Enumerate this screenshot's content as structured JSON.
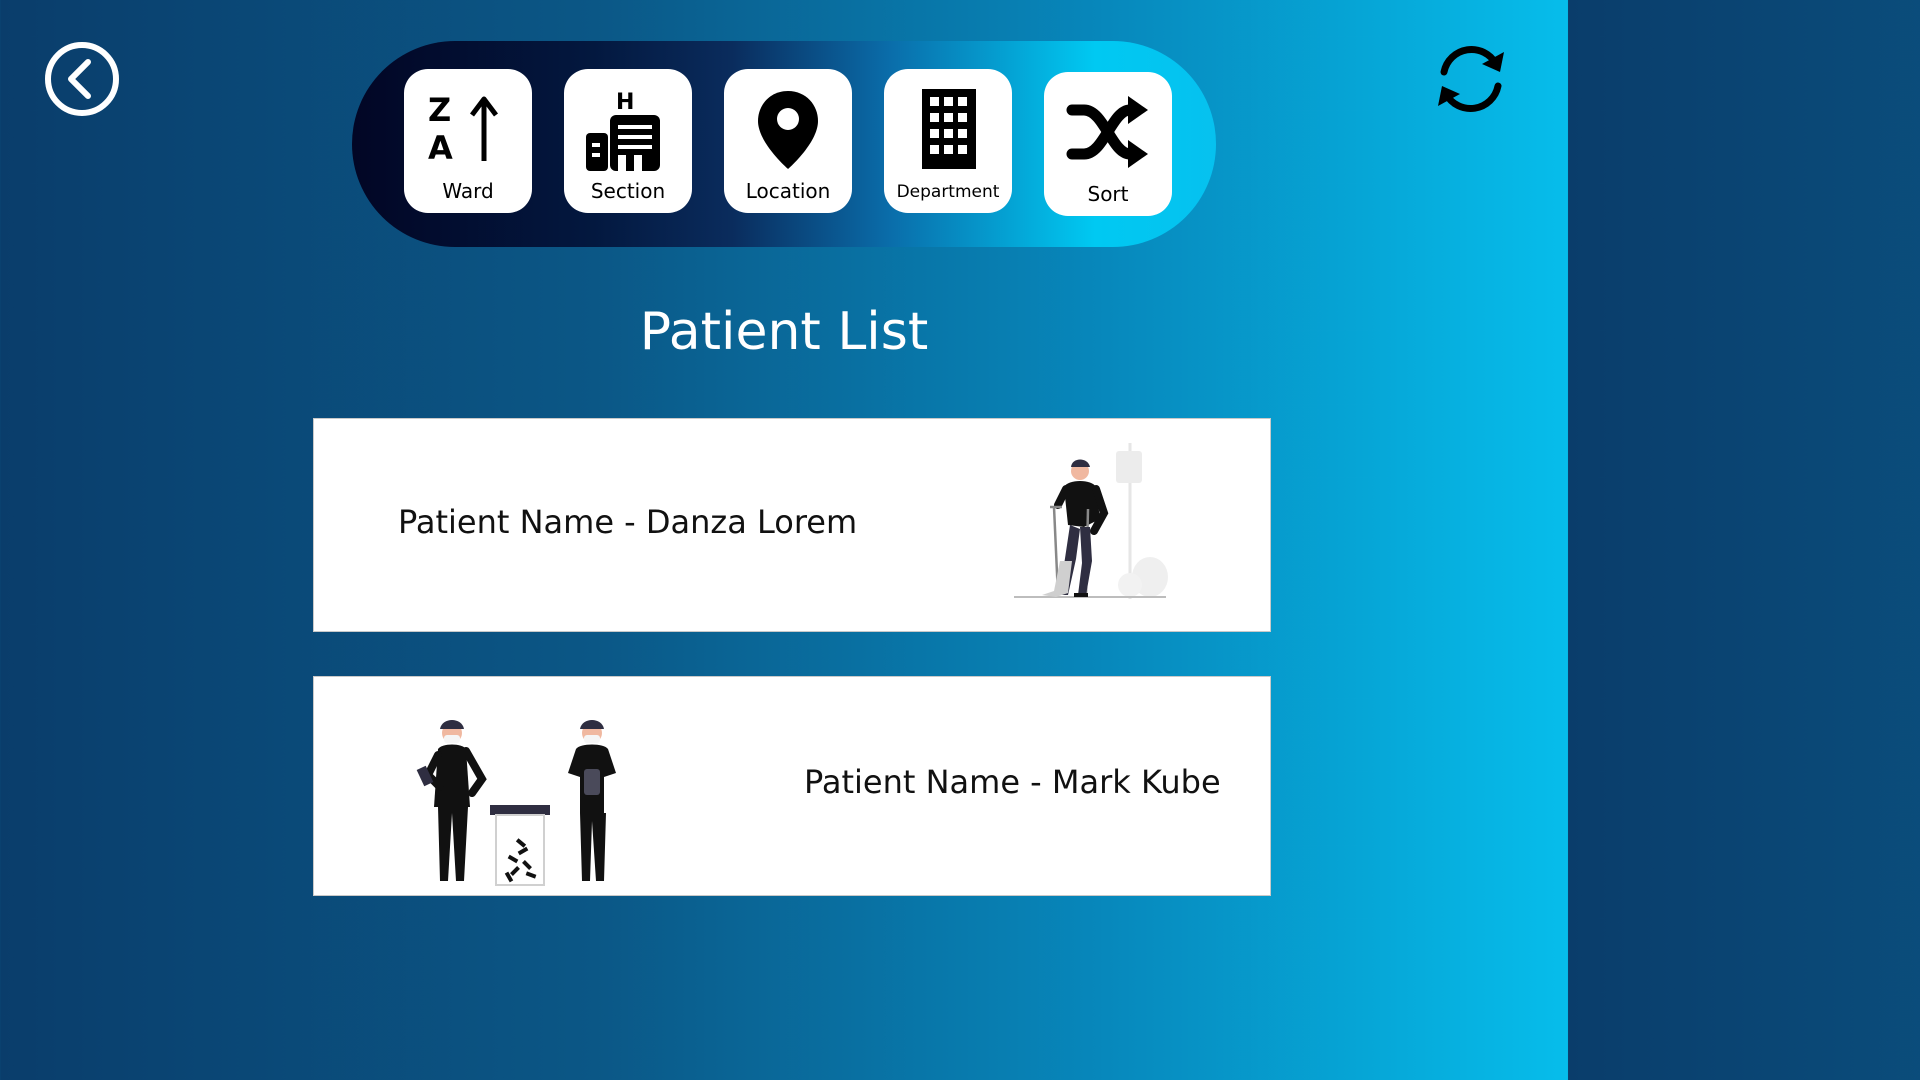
{
  "header": {
    "back_icon": "chevron-left-circle-icon",
    "refresh_icon": "refresh-icon"
  },
  "filters": [
    {
      "label": "Ward",
      "icon": "sort-za-ascending-icon"
    },
    {
      "label": "Section",
      "icon": "hospital-building-icon"
    },
    {
      "label": "Location",
      "icon": "location-pin-icon"
    },
    {
      "label": "Department",
      "icon": "office-building-icon"
    },
    {
      "label": "Sort",
      "icon": "shuffle-icon"
    }
  ],
  "title": "Patient List",
  "patients": [
    {
      "name": "Patient Name - Danza Lorem",
      "illustration": "patient-on-crutches-illustration"
    },
    {
      "name": "Patient Name - Mark Kube",
      "illustration": "doctors-with-medicine-jar-illustration"
    }
  ],
  "colors": {
    "background_start": "#0a3d6b",
    "background_end": "#06bdeb",
    "card": "#ffffff",
    "text_dark": "#111111"
  }
}
